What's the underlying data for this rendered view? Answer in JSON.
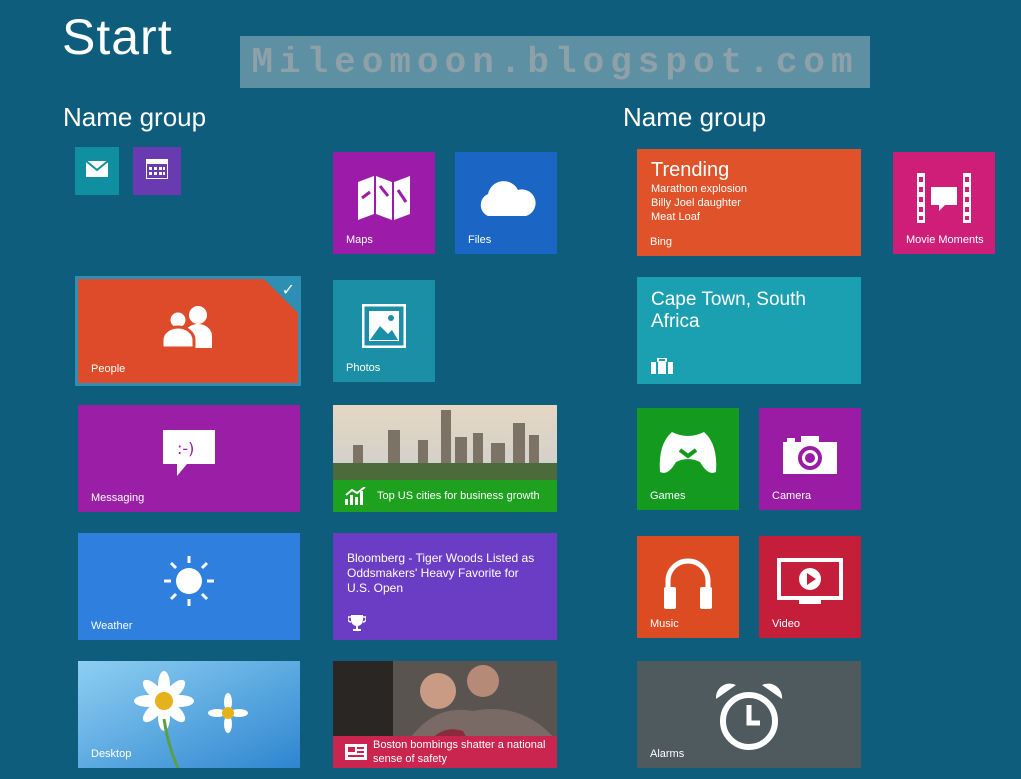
{
  "header": {
    "title": "Start",
    "watermark": "Mileomoon.blogspot.com"
  },
  "groups": {
    "left_label": "Name group",
    "right_label": "Name group"
  },
  "tiles": {
    "mail": {
      "label": "",
      "icon": "mail-icon",
      "color": "#0f8fa0"
    },
    "calendar": {
      "label": "",
      "icon": "calendar-icon",
      "color": "#6a3bb0"
    },
    "maps": {
      "label": "Maps",
      "icon": "maps-icon",
      "color": "#9c1ba8"
    },
    "files": {
      "label": "Files",
      "icon": "cloud-icon",
      "color": "#1b66c4"
    },
    "people": {
      "label": "People",
      "icon": "people-icon",
      "color": "#dd4b2a"
    },
    "photos": {
      "label": "Photos",
      "icon": "photo-icon",
      "color": "#1a8fa6"
    },
    "messaging": {
      "label": "Messaging",
      "icon": "message-icon",
      "color": "#9a1fa6"
    },
    "finance": {
      "label": "Top US cities for business growth",
      "icon": "chart-icon",
      "color": "#1ea11e"
    },
    "weather": {
      "label": "Weather",
      "icon": "sun-icon",
      "color": "#2e7fde"
    },
    "sports": {
      "label": "Bloomberg - Tiger Woods Listed as Oddsmakers' Heavy Favorite for U.S. Open",
      "icon": "trophy-icon",
      "color": "#6a3dc4"
    },
    "desktop": {
      "label": "Desktop",
      "icon": "flower-icon",
      "color": "#4aa6e0"
    },
    "news": {
      "label": "Boston bombings shatter a national sense of safety",
      "icon": "newspaper-icon",
      "color": "#c9254f"
    },
    "bing": {
      "label": "Bing",
      "title": "Trending",
      "items": [
        "Marathon explosion",
        "Billy Joel daughter",
        "Meat Loaf"
      ],
      "color": "#e0532a"
    },
    "movie": {
      "label": "Movie Moments",
      "icon": "film-icon",
      "color": "#cf1e78"
    },
    "travel": {
      "label": "",
      "title": "Cape Town, South Africa",
      "icon": "suitcase-icon",
      "color": "#1aa0b0"
    },
    "games": {
      "label": "Games",
      "icon": "gamepad-icon",
      "color": "#139a1f"
    },
    "camera": {
      "label": "Camera",
      "icon": "camera-icon",
      "color": "#9a1ba4"
    },
    "music": {
      "label": "Music",
      "icon": "headphones-icon",
      "color": "#dd4b22"
    },
    "video": {
      "label": "Video",
      "icon": "video-icon",
      "color": "#c41e3a"
    },
    "alarms": {
      "label": "Alarms",
      "icon": "alarm-icon",
      "color": "#4f5a5e"
    }
  }
}
